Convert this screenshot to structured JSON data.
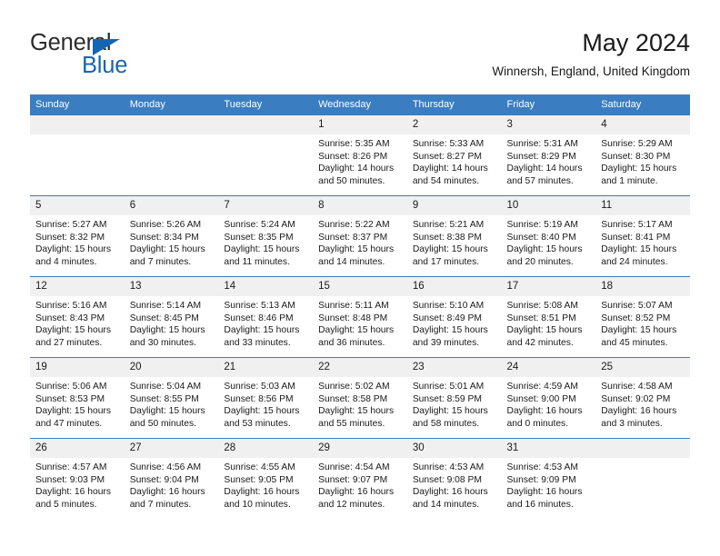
{
  "brand": {
    "name_part1": "General",
    "name_part2": "Blue",
    "triangle_color": "#1565b4",
    "text_color": "#2b2b2b"
  },
  "header": {
    "title": "May 2024",
    "subtitle": "Winnersh, England, United Kingdom"
  },
  "theme": {
    "header_bg": "#3a7dc1",
    "header_text": "#ffffff",
    "daynum_bg": "#f0f0f0",
    "cell_bg": "#ffffff",
    "border": "#3a7dc1"
  },
  "weekdays": [
    "Sunday",
    "Monday",
    "Tuesday",
    "Wednesday",
    "Thursday",
    "Friday",
    "Saturday"
  ],
  "labels": {
    "sunrise_prefix": "Sunrise:",
    "sunset_prefix": "Sunset:",
    "daylight_prefix": "Daylight:"
  },
  "weeks": [
    [
      {
        "day": "",
        "sunrise": "",
        "sunset": "",
        "daylight": "",
        "empty": true
      },
      {
        "day": "",
        "sunrise": "",
        "sunset": "",
        "daylight": "",
        "empty": true
      },
      {
        "day": "",
        "sunrise": "",
        "sunset": "",
        "daylight": "",
        "empty": true
      },
      {
        "day": "1",
        "sunrise": "Sunrise: 5:35 AM",
        "sunset": "Sunset: 8:26 PM",
        "daylight": "Daylight: 14 hours and 50 minutes."
      },
      {
        "day": "2",
        "sunrise": "Sunrise: 5:33 AM",
        "sunset": "Sunset: 8:27 PM",
        "daylight": "Daylight: 14 hours and 54 minutes."
      },
      {
        "day": "3",
        "sunrise": "Sunrise: 5:31 AM",
        "sunset": "Sunset: 8:29 PM",
        "daylight": "Daylight: 14 hours and 57 minutes."
      },
      {
        "day": "4",
        "sunrise": "Sunrise: 5:29 AM",
        "sunset": "Sunset: 8:30 PM",
        "daylight": "Daylight: 15 hours and 1 minute."
      }
    ],
    [
      {
        "day": "5",
        "sunrise": "Sunrise: 5:27 AM",
        "sunset": "Sunset: 8:32 PM",
        "daylight": "Daylight: 15 hours and 4 minutes."
      },
      {
        "day": "6",
        "sunrise": "Sunrise: 5:26 AM",
        "sunset": "Sunset: 8:34 PM",
        "daylight": "Daylight: 15 hours and 7 minutes."
      },
      {
        "day": "7",
        "sunrise": "Sunrise: 5:24 AM",
        "sunset": "Sunset: 8:35 PM",
        "daylight": "Daylight: 15 hours and 11 minutes."
      },
      {
        "day": "8",
        "sunrise": "Sunrise: 5:22 AM",
        "sunset": "Sunset: 8:37 PM",
        "daylight": "Daylight: 15 hours and 14 minutes."
      },
      {
        "day": "9",
        "sunrise": "Sunrise: 5:21 AM",
        "sunset": "Sunset: 8:38 PM",
        "daylight": "Daylight: 15 hours and 17 minutes."
      },
      {
        "day": "10",
        "sunrise": "Sunrise: 5:19 AM",
        "sunset": "Sunset: 8:40 PM",
        "daylight": "Daylight: 15 hours and 20 minutes."
      },
      {
        "day": "11",
        "sunrise": "Sunrise: 5:17 AM",
        "sunset": "Sunset: 8:41 PM",
        "daylight": "Daylight: 15 hours and 24 minutes."
      }
    ],
    [
      {
        "day": "12",
        "sunrise": "Sunrise: 5:16 AM",
        "sunset": "Sunset: 8:43 PM",
        "daylight": "Daylight: 15 hours and 27 minutes."
      },
      {
        "day": "13",
        "sunrise": "Sunrise: 5:14 AM",
        "sunset": "Sunset: 8:45 PM",
        "daylight": "Daylight: 15 hours and 30 minutes."
      },
      {
        "day": "14",
        "sunrise": "Sunrise: 5:13 AM",
        "sunset": "Sunset: 8:46 PM",
        "daylight": "Daylight: 15 hours and 33 minutes."
      },
      {
        "day": "15",
        "sunrise": "Sunrise: 5:11 AM",
        "sunset": "Sunset: 8:48 PM",
        "daylight": "Daylight: 15 hours and 36 minutes."
      },
      {
        "day": "16",
        "sunrise": "Sunrise: 5:10 AM",
        "sunset": "Sunset: 8:49 PM",
        "daylight": "Daylight: 15 hours and 39 minutes."
      },
      {
        "day": "17",
        "sunrise": "Sunrise: 5:08 AM",
        "sunset": "Sunset: 8:51 PM",
        "daylight": "Daylight: 15 hours and 42 minutes."
      },
      {
        "day": "18",
        "sunrise": "Sunrise: 5:07 AM",
        "sunset": "Sunset: 8:52 PM",
        "daylight": "Daylight: 15 hours and 45 minutes."
      }
    ],
    [
      {
        "day": "19",
        "sunrise": "Sunrise: 5:06 AM",
        "sunset": "Sunset: 8:53 PM",
        "daylight": "Daylight: 15 hours and 47 minutes."
      },
      {
        "day": "20",
        "sunrise": "Sunrise: 5:04 AM",
        "sunset": "Sunset: 8:55 PM",
        "daylight": "Daylight: 15 hours and 50 minutes."
      },
      {
        "day": "21",
        "sunrise": "Sunrise: 5:03 AM",
        "sunset": "Sunset: 8:56 PM",
        "daylight": "Daylight: 15 hours and 53 minutes."
      },
      {
        "day": "22",
        "sunrise": "Sunrise: 5:02 AM",
        "sunset": "Sunset: 8:58 PM",
        "daylight": "Daylight: 15 hours and 55 minutes."
      },
      {
        "day": "23",
        "sunrise": "Sunrise: 5:01 AM",
        "sunset": "Sunset: 8:59 PM",
        "daylight": "Daylight: 15 hours and 58 minutes."
      },
      {
        "day": "24",
        "sunrise": "Sunrise: 4:59 AM",
        "sunset": "Sunset: 9:00 PM",
        "daylight": "Daylight: 16 hours and 0 minutes."
      },
      {
        "day": "25",
        "sunrise": "Sunrise: 4:58 AM",
        "sunset": "Sunset: 9:02 PM",
        "daylight": "Daylight: 16 hours and 3 minutes."
      }
    ],
    [
      {
        "day": "26",
        "sunrise": "Sunrise: 4:57 AM",
        "sunset": "Sunset: 9:03 PM",
        "daylight": "Daylight: 16 hours and 5 minutes."
      },
      {
        "day": "27",
        "sunrise": "Sunrise: 4:56 AM",
        "sunset": "Sunset: 9:04 PM",
        "daylight": "Daylight: 16 hours and 7 minutes."
      },
      {
        "day": "28",
        "sunrise": "Sunrise: 4:55 AM",
        "sunset": "Sunset: 9:05 PM",
        "daylight": "Daylight: 16 hours and 10 minutes."
      },
      {
        "day": "29",
        "sunrise": "Sunrise: 4:54 AM",
        "sunset": "Sunset: 9:07 PM",
        "daylight": "Daylight: 16 hours and 12 minutes."
      },
      {
        "day": "30",
        "sunrise": "Sunrise: 4:53 AM",
        "sunset": "Sunset: 9:08 PM",
        "daylight": "Daylight: 16 hours and 14 minutes."
      },
      {
        "day": "31",
        "sunrise": "Sunrise: 4:53 AM",
        "sunset": "Sunset: 9:09 PM",
        "daylight": "Daylight: 16 hours and 16 minutes."
      },
      {
        "day": "",
        "sunrise": "",
        "sunset": "",
        "daylight": "",
        "empty": true
      }
    ]
  ]
}
